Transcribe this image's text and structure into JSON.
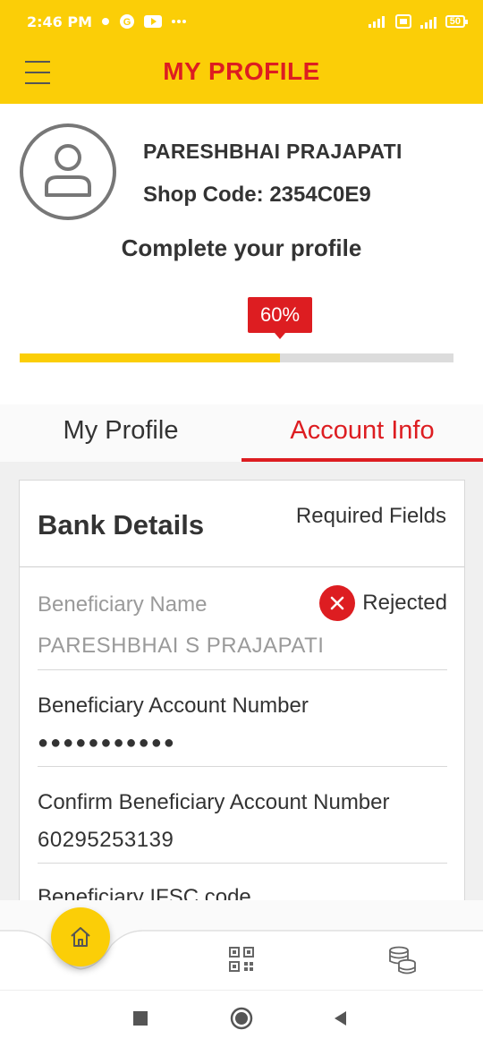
{
  "status_bar": {
    "time": "2:46 PM",
    "battery": "50"
  },
  "header": {
    "title": "MY PROFILE"
  },
  "profile": {
    "name": "PARESHBHAI PRAJAPATI",
    "shop_code": "Shop Code: 2354C0E9",
    "complete_label": "Complete your profile",
    "progress_label": "60%",
    "progress": 0.6
  },
  "tabs": [
    {
      "label": "My Profile",
      "active": false
    },
    {
      "label": "Account Info",
      "active": true
    }
  ],
  "bank_details": {
    "title": "Bank Details",
    "required_label": "Required Fields",
    "fields": [
      {
        "label": "Beneficiary Name",
        "value": "PARESHBHAI S PRAJAPATI",
        "status": "Rejected"
      },
      {
        "label": "Beneficiary Account Number",
        "value": "●●●●●●●●●●●"
      },
      {
        "label": "Confirm Beneficiary Account Number",
        "value": "60295253139"
      },
      {
        "label": "Beneficiary IFSC code",
        "value": ""
      }
    ]
  },
  "bottom_nav": {
    "items": [
      "home-icon",
      "qr-code-icon",
      "coins-icon"
    ]
  },
  "colors": {
    "brand_yellow": "#fbce07",
    "brand_red": "#dd1d21"
  }
}
